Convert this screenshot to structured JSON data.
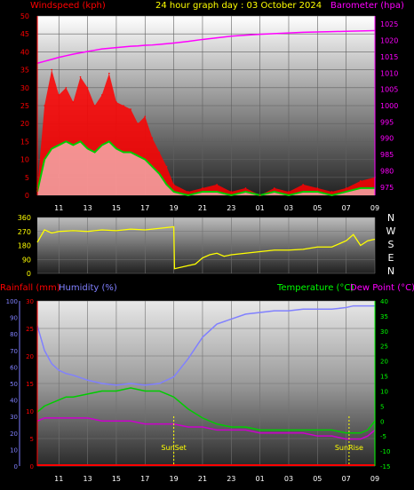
{
  "header": {
    "wind_label": "Windspeed (kph)",
    "title": "24 hour graph day : 03 October 2024",
    "baro_label": "Barometer (hpa)"
  },
  "colors": {
    "wind_axis": "#ff0000",
    "baro_axis": "#ff00ff",
    "wind_series": "#ff0000",
    "avg_wind_series": "#00cc00",
    "gust_fill": "#ffffff",
    "barometer_series": "#ff00ff",
    "direction_series": "#ffff00",
    "rain_axis": "#ff0000",
    "humidity_axis": "#8080ff",
    "temp_axis": "#00ff00",
    "dew_axis": "#ff00ff",
    "humidity_series": "#8080ff",
    "temp_series": "#00cc00",
    "dew_series": "#cc00cc",
    "sun_marker": "#ffff00"
  },
  "x_ticks": [
    "11",
    "13",
    "15",
    "17",
    "19",
    "21",
    "23",
    "01",
    "03",
    "05",
    "07",
    "09"
  ],
  "panel_mid": {
    "compass_labels": [
      "N",
      "W",
      "S",
      "E",
      "N"
    ],
    "y_ticks": [
      "360",
      "270",
      "180",
      "90",
      "0"
    ]
  },
  "panel_bottom": {
    "rain_label": "Rainfall (mm)",
    "humidity_label": "Humidity (%)",
    "temp_label": "Temperature (°C)",
    "dew_label": "Dew Point (°C)",
    "sunset_label": "SunSet",
    "sunrise_label": "SunRise"
  },
  "chart_data": [
    {
      "type": "line",
      "title": "24 hour graph day : 03 October 2024",
      "ylabel": "Windspeed (kph)",
      "y2label": "Barometer (hpa)",
      "ylim": [
        0,
        50
      ],
      "y_ticks": [
        0,
        5,
        10,
        15,
        20,
        25,
        30,
        35,
        40,
        45,
        50
      ],
      "y2lim": [
        972.5,
        1027.5
      ],
      "y2_ticks": [
        975,
        980,
        985,
        990,
        995,
        1000,
        1005,
        1010,
        1015,
        1020,
        1025
      ],
      "x_hours": [
        9.5,
        10,
        10.5,
        11,
        11.5,
        12,
        12.5,
        13,
        13.5,
        14,
        14.5,
        15,
        15.5,
        16,
        16.5,
        17,
        17.5,
        18,
        18.5,
        19,
        20,
        21,
        22,
        23,
        24,
        25,
        26,
        27,
        28,
        29,
        30,
        31,
        32,
        33
      ],
      "series": [
        {
          "name": "Windspeed (kph)",
          "role": "gust",
          "values": [
            2,
            25,
            35,
            28,
            30,
            26,
            33,
            30,
            25,
            28,
            34,
            26,
            25,
            24,
            20,
            22,
            16,
            12,
            8,
            3,
            1,
            2,
            3,
            1,
            2,
            0,
            2,
            1,
            3,
            2,
            1,
            2,
            4,
            5
          ]
        },
        {
          "name": "Average windspeed",
          "role": "average",
          "values": [
            1,
            10,
            13,
            14,
            15,
            14,
            15,
            13,
            12,
            14,
            15,
            13,
            12,
            12,
            11,
            10,
            8,
            6,
            3,
            1,
            0,
            1,
            1,
            0,
            1,
            0,
            1,
            0,
            1,
            1,
            0,
            1,
            2,
            2
          ]
        },
        {
          "name": "Barometer (hpa)",
          "role": "barometer",
          "values": [
            1013.0,
            1013.6,
            1014.2,
            1014.8,
            1015.3,
            1015.8,
            1016.2,
            1016.6,
            1017.0,
            1017.4,
            1017.6,
            1017.8,
            1018.0,
            1018.2,
            1018.3,
            1018.5,
            1018.6,
            1018.8,
            1019.0,
            1019.2,
            1019.7,
            1020.3,
            1020.8,
            1021.3,
            1021.6,
            1021.9,
            1022.1,
            1022.3,
            1022.5,
            1022.6,
            1022.7,
            1022.8,
            1022.9,
            1023.0
          ]
        }
      ]
    },
    {
      "type": "line",
      "ylabel": "Wind direction",
      "ylim": [
        0,
        360
      ],
      "y_ticks": [
        0,
        90,
        180,
        270,
        360
      ],
      "series": [
        {
          "name": "Wind direction",
          "x_hours": [
            9.5,
            10,
            10.5,
            11,
            12,
            13,
            14,
            15,
            16,
            17,
            18,
            19,
            19.05,
            20,
            20.5,
            21,
            21.5,
            22,
            22.5,
            23,
            24,
            25,
            26,
            27,
            28,
            29,
            30,
            31,
            31.5,
            32,
            32.5,
            33
          ],
          "values": [
            200,
            280,
            260,
            270,
            275,
            270,
            280,
            275,
            285,
            280,
            290,
            300,
            30,
            50,
            60,
            100,
            120,
            130,
            110,
            120,
            130,
            140,
            150,
            150,
            155,
            170,
            170,
            210,
            250,
            180,
            210,
            220
          ]
        }
      ]
    },
    {
      "type": "line",
      "ylabel": "Rainfall (mm)",
      "y2label": "Humidity (%)",
      "y3label": "Temperature (°C)",
      "y4label": "Dew Point (°C)",
      "rain_ylim": [
        0,
        30
      ],
      "rain_ticks": [
        0,
        5,
        10,
        15,
        20,
        25,
        30
      ],
      "humidity_ylim": [
        0,
        100
      ],
      "humidity_ticks": [
        0,
        10,
        20,
        30,
        40,
        50,
        60,
        70,
        80,
        90,
        100
      ],
      "temp_ylim": [
        -15,
        40
      ],
      "temp_ticks": [
        -15,
        -10,
        -5,
        0,
        5,
        10,
        15,
        20,
        25,
        30,
        35,
        40
      ],
      "x_hours": [
        9.5,
        10,
        10.5,
        11,
        11.5,
        12,
        13,
        14,
        15,
        16,
        17,
        18,
        18.5,
        19,
        20,
        21,
        22,
        23,
        24,
        25,
        26,
        27,
        28,
        29,
        30,
        31,
        31.5,
        32,
        32.5,
        33
      ],
      "series": [
        {
          "name": "Humidity (%)",
          "values": [
            85,
            70,
            62,
            58,
            56,
            55,
            52,
            50,
            49,
            50,
            49,
            50,
            52,
            54,
            65,
            78,
            86,
            89,
            92,
            93,
            94,
            94,
            95,
            95,
            95,
            96,
            97,
            97,
            97,
            97
          ]
        },
        {
          "name": "Temperature (°C)",
          "values": [
            3,
            5,
            6,
            7,
            8,
            8,
            9,
            10,
            10,
            11,
            10,
            10,
            9,
            8,
            4,
            1,
            -1,
            -2,
            -2,
            -3,
            -3,
            -3,
            -3,
            -3,
            -3,
            -4,
            -4,
            -4,
            -3,
            0
          ]
        },
        {
          "name": "Dew Point (°C)",
          "values": [
            0,
            1,
            1,
            1,
            1,
            1,
            1,
            0,
            0,
            0,
            -1,
            -1,
            -1,
            -1,
            -2,
            -2,
            -3,
            -3,
            -3,
            -4,
            -4,
            -4,
            -4,
            -5,
            -5,
            -6,
            -6,
            -6,
            -5,
            -3
          ]
        },
        {
          "name": "Rainfall (mm)",
          "values": [
            0,
            0,
            0,
            0,
            0,
            0,
            0,
            0,
            0,
            0,
            0,
            0,
            0,
            0,
            0,
            0,
            0,
            0,
            0,
            0,
            0,
            0,
            0,
            0,
            0,
            0,
            0,
            0,
            0,
            0
          ]
        }
      ],
      "markers": [
        {
          "label": "SunSet",
          "x_hour": 19
        },
        {
          "label": "SunRise",
          "x_hour": 31.2
        }
      ]
    }
  ]
}
